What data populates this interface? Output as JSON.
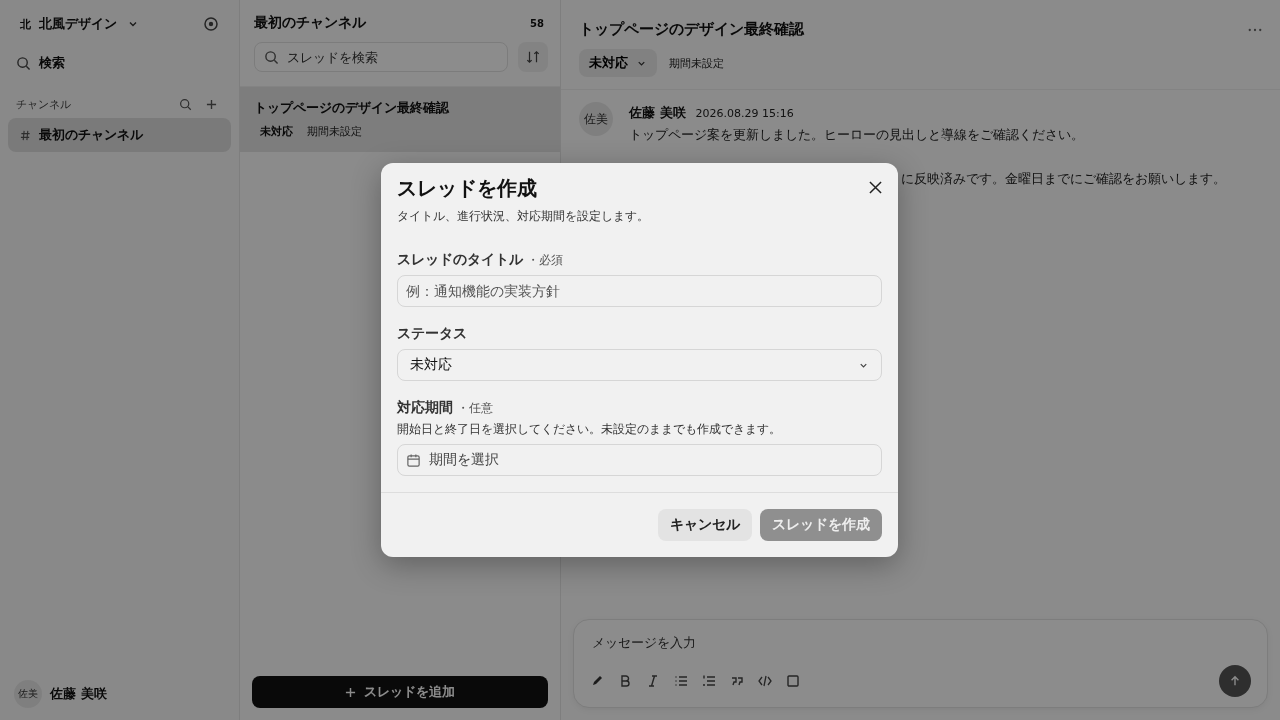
{
  "sidebar": {
    "workspace": {
      "initial": "北",
      "name": "北風デザイン"
    },
    "search": "検索",
    "section": "チャンネル",
    "channels": [
      {
        "name": "最初のチャンネル",
        "selected": true
      }
    ],
    "user": {
      "initials": "佐美",
      "name": "佐藤 美咲"
    }
  },
  "thread_list": {
    "title": "最初のチャンネル",
    "count": "58",
    "search": {
      "placeholder": "スレッドを検索"
    },
    "threads": [
      {
        "title": "トップページのデザイン最終確認",
        "status": "未対応",
        "period": "期間未設定",
        "selected": true
      }
    ],
    "add_button": "スレッドを追加"
  },
  "main": {
    "title": "トップページのデザイン最終確認",
    "status": "未対応",
    "period": "期間未設定",
    "messages": [
      {
        "initials": "佐美",
        "author": "佐藤 美咲",
        "time": "2026.08.29 15:16",
        "text": "トップページ案を更新しました。ヒーローの見出しと導線をご確認ください。"
      }
    ],
    "hidden_message_tail": "に反映済みです。金曜日までにご確認をお願いします。",
    "composer": {
      "placeholder": "メッセージを入力"
    }
  },
  "dialog": {
    "title": "スレッドを作成",
    "subtitle": "タイトル、進行状況、対応期間を設定します。",
    "fields": [
      {
        "kind": "text",
        "label": "スレッドのタイトル",
        "tag": "・必須",
        "placeholder": "例：通知機能の実装方針"
      },
      {
        "kind": "select",
        "label": "ステータス",
        "value": "未対応"
      },
      {
        "kind": "date",
        "label": "対応期間",
        "tag": "・任意",
        "help": "開始日と終了日を選択してください。未設定のままでも作成できます。",
        "placeholder": "期間を選択"
      }
    ],
    "cancel": "キャンセル",
    "submit": {
      "label": "スレッドを作成",
      "disabled": true
    }
  }
}
